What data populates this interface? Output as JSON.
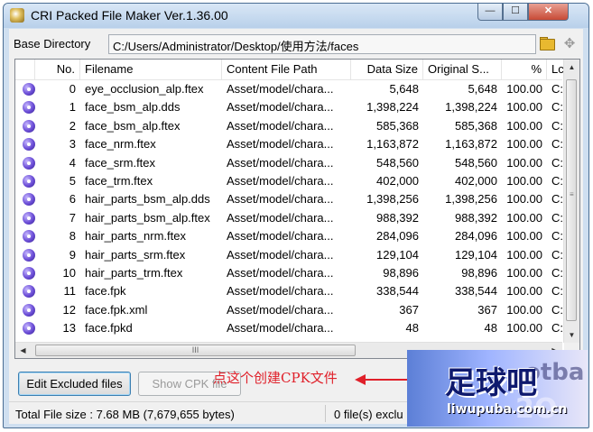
{
  "window": {
    "title": "CRI Packed File Maker Ver.1.36.00",
    "min": "—",
    "max": "☐",
    "close": "✕"
  },
  "base_directory": {
    "label": "Base Directory",
    "value": "C:/Users/Administrator/Desktop/使用方法/faces"
  },
  "columns": {
    "no": "No.",
    "filename": "Filename",
    "content_path": "Content File Path",
    "data_size": "Data Size",
    "original_size": "Original S...",
    "percent": "%",
    "loc": "Lc"
  },
  "files": [
    {
      "no": "0",
      "filename": "eye_occlusion_alp.ftex",
      "path": "Asset/model/chara...",
      "data_size": "5,648",
      "original_size": "5,648",
      "percent": "100.00",
      "loc": "C:"
    },
    {
      "no": "1",
      "filename": "face_bsm_alp.dds",
      "path": "Asset/model/chara...",
      "data_size": "1,398,224",
      "original_size": "1,398,224",
      "percent": "100.00",
      "loc": "C:"
    },
    {
      "no": "2",
      "filename": "face_bsm_alp.ftex",
      "path": "Asset/model/chara...",
      "data_size": "585,368",
      "original_size": "585,368",
      "percent": "100.00",
      "loc": "C:"
    },
    {
      "no": "3",
      "filename": "face_nrm.ftex",
      "path": "Asset/model/chara...",
      "data_size": "1,163,872",
      "original_size": "1,163,872",
      "percent": "100.00",
      "loc": "C:"
    },
    {
      "no": "4",
      "filename": "face_srm.ftex",
      "path": "Asset/model/chara...",
      "data_size": "548,560",
      "original_size": "548,560",
      "percent": "100.00",
      "loc": "C:"
    },
    {
      "no": "5",
      "filename": "face_trm.ftex",
      "path": "Asset/model/chara...",
      "data_size": "402,000",
      "original_size": "402,000",
      "percent": "100.00",
      "loc": "C:"
    },
    {
      "no": "6",
      "filename": "hair_parts_bsm_alp.dds",
      "path": "Asset/model/chara...",
      "data_size": "1,398,256",
      "original_size": "1,398,256",
      "percent": "100.00",
      "loc": "C:"
    },
    {
      "no": "7",
      "filename": "hair_parts_bsm_alp.ftex",
      "path": "Asset/model/chara...",
      "data_size": "988,392",
      "original_size": "988,392",
      "percent": "100.00",
      "loc": "C:"
    },
    {
      "no": "8",
      "filename": "hair_parts_nrm.ftex",
      "path": "Asset/model/chara...",
      "data_size": "284,096",
      "original_size": "284,096",
      "percent": "100.00",
      "loc": "C:"
    },
    {
      "no": "9",
      "filename": "hair_parts_srm.ftex",
      "path": "Asset/model/chara...",
      "data_size": "129,104",
      "original_size": "129,104",
      "percent": "100.00",
      "loc": "C:"
    },
    {
      "no": "10",
      "filename": "hair_parts_trm.ftex",
      "path": "Asset/model/chara...",
      "data_size": "98,896",
      "original_size": "98,896",
      "percent": "100.00",
      "loc": "C:"
    },
    {
      "no": "11",
      "filename": "face.fpk",
      "path": "Asset/model/chara...",
      "data_size": "338,544",
      "original_size": "338,544",
      "percent": "100.00",
      "loc": "C:"
    },
    {
      "no": "12",
      "filename": "face.fpk.xml",
      "path": "Asset/model/chara...",
      "data_size": "367",
      "original_size": "367",
      "percent": "100.00",
      "loc": "C:"
    },
    {
      "no": "13",
      "filename": "face.fpkd",
      "path": "Asset/model/chara...",
      "data_size": "48",
      "original_size": "48",
      "percent": "100.00",
      "loc": "C:"
    }
  ],
  "buttons": {
    "edit_excluded": "Edit Excluded files",
    "show_cpk": "Show CPK file"
  },
  "annotation": "点这个创建CPK文件",
  "status": {
    "total": "Total File size : 7.68 MB (7,679,655 bytes)",
    "excluded": "0 file(s) exclu"
  },
  "watermark": {
    "logo": "足球吧",
    "url": "liwupuba.com.cn",
    "bg_text": "otba",
    "bg_num": "2O"
  }
}
